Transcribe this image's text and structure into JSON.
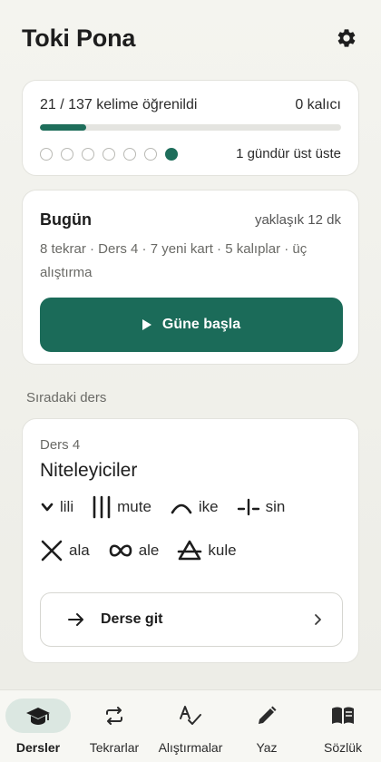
{
  "header": {
    "title": "Toki Pona",
    "settings_icon": "gear-icon"
  },
  "progress": {
    "learned_label": "21 / 137 kelime öğrenildi",
    "permanent_label": "0 kalıcı",
    "learned_fraction": 0.153,
    "streak_days_total": 7,
    "streak_days_filled": 1,
    "streak_label": "1 gündür üst üste"
  },
  "today": {
    "title": "Bugün",
    "estimate": "yaklaşık 12 dk",
    "description": "8 tekrar · Ders 4 · 7 yeni kart · 5 kalıplar · üç alıştırma",
    "start_button": "Güne başla"
  },
  "next_lesson": {
    "section_label": "Sıradaki ders",
    "lesson_number": "Ders 4",
    "title": "Niteleyiciler",
    "words": [
      {
        "label": "lili",
        "glyph": "lili-glyph"
      },
      {
        "label": "mute",
        "glyph": "mute-glyph"
      },
      {
        "label": "ike",
        "glyph": "ike-glyph"
      },
      {
        "label": "sin",
        "glyph": "sin-glyph"
      },
      {
        "label": "ala",
        "glyph": "ala-glyph"
      },
      {
        "label": "ale",
        "glyph": "ale-glyph"
      },
      {
        "label": "kule",
        "glyph": "kule-glyph"
      }
    ],
    "goto_button": "Derse git"
  },
  "nav": {
    "items": [
      {
        "label": "Dersler",
        "icon": "graduation-cap-icon",
        "active": true
      },
      {
        "label": "Tekrarlar",
        "icon": "repeat-icon",
        "active": false
      },
      {
        "label": "Alıştırmalar",
        "icon": "spellcheck-icon",
        "active": false
      },
      {
        "label": "Yaz",
        "icon": "pencil-icon",
        "active": false
      },
      {
        "label": "Sözlük",
        "icon": "book-icon",
        "active": false
      }
    ]
  },
  "colors": {
    "accent": "#1b6b59",
    "active_nav_bg": "#dbe7e1"
  }
}
